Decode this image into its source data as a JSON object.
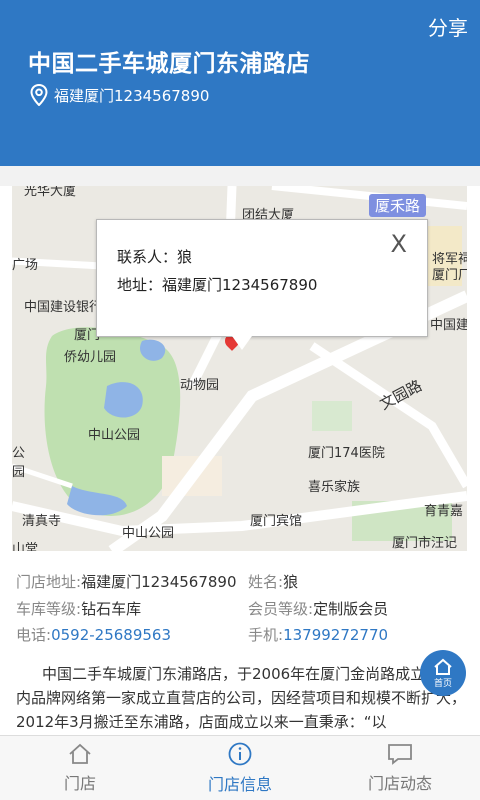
{
  "header": {
    "share_label": "分享",
    "title": "中国二手车城厦门东浦路店",
    "location": "福建厦门1234567890"
  },
  "map": {
    "road_chip": "厦禾路",
    "labels": [
      "光华大厦",
      "团结大厦",
      "将军祠",
      "厦门厂",
      "广场",
      "中国建设银行",
      "中国建",
      "厦门",
      "侨幼儿园",
      "动物园",
      "中山公园",
      "文园路",
      "厦门174医院",
      "喜乐家族",
      "公园",
      "清真寺",
      "中山公园",
      "厦门宾馆",
      "育青嘉",
      "厦门市汪记",
      "山堂"
    ],
    "popup": {
      "contact": "联系人：狼",
      "address": "地址：福建厦门1234567890",
      "close": "X"
    }
  },
  "info": {
    "address_label": "门店地址:",
    "address_value": "福建厦门1234567890",
    "name_label": "姓名:",
    "name_value": "狼",
    "garage_label": "车库等级:",
    "garage_value": "钻石车库",
    "member_label": "会员等级:",
    "member_value": "定制版会员",
    "phone_label": "电话:",
    "phone_value": "0592-25689563",
    "mobile_label": "手机:",
    "mobile_value": "13799272770"
  },
  "description": "中国二手车城厦门东浦路店，于2006年在厦门金尚路成立是国内品牌网络第一家成立直营店的公司，因经营项目和规模不断扩大，2012年3月搬迁至东浦路，店面成立以来一直秉承：“以",
  "home_fab": "首页",
  "tabs": [
    {
      "label": "门店",
      "icon": "home-icon"
    },
    {
      "label": "门店信息",
      "icon": "info-icon"
    },
    {
      "label": "门店动态",
      "icon": "message-icon"
    }
  ],
  "colors": {
    "primary": "#2f78c4",
    "pin": "#e53935"
  }
}
